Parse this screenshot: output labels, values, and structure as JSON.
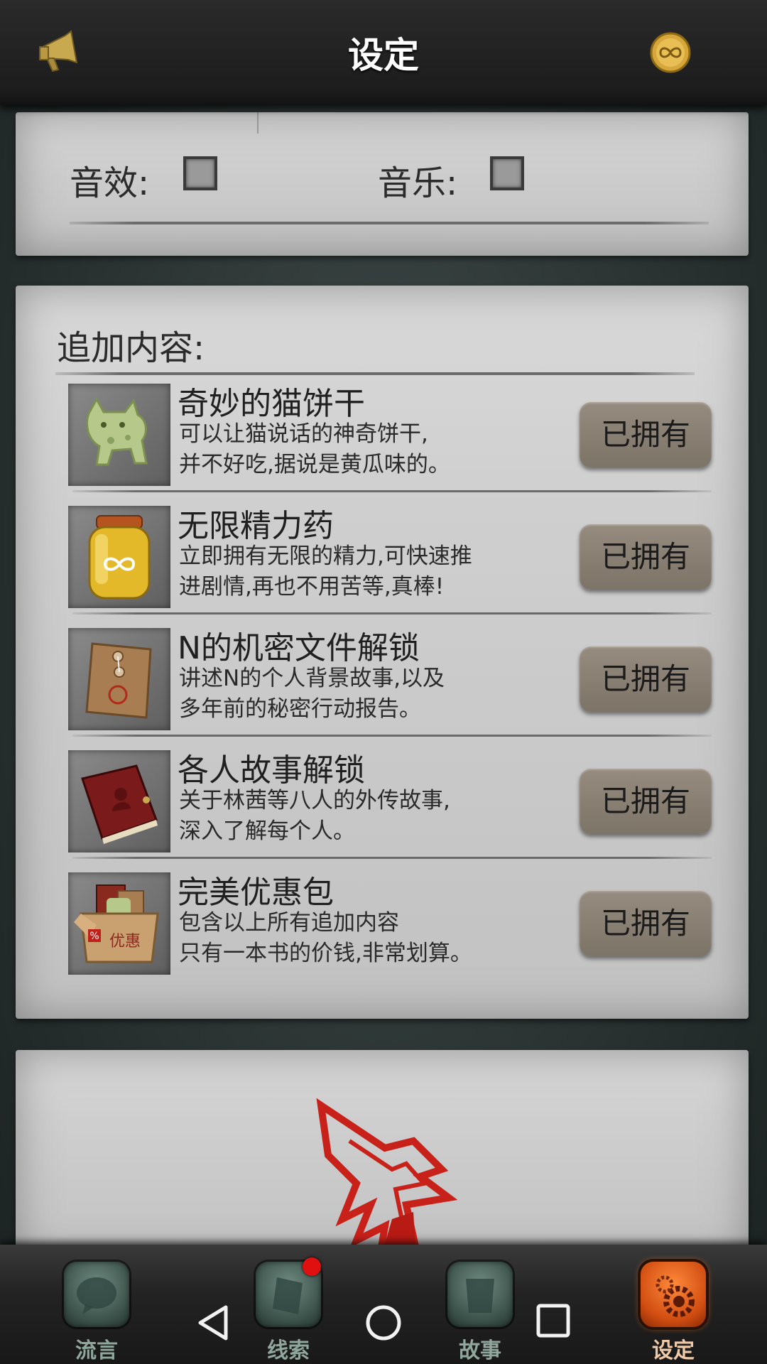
{
  "header": {
    "title": "设定",
    "left_icon": "megaphone-icon",
    "right_icon": "infinity-coin-icon"
  },
  "settings": {
    "sound_effects_label": "音效:",
    "sound_effects_checked": false,
    "music_label": "音乐:",
    "music_checked": false
  },
  "extras": {
    "title": "追加内容:",
    "items": [
      {
        "name": "奇妙的猫饼干",
        "desc": "可以让猫说话的神奇饼干,\n并不好吃,据说是黄瓜味的。",
        "button": "已拥有",
        "icon": "cat-cookie-icon"
      },
      {
        "name": "无限精力药",
        "desc": "立即拥有无限的精力,可快速推\n进剧情,再也不用苦等,真棒!",
        "button": "已拥有",
        "icon": "energy-potion-jar-icon"
      },
      {
        "name": "N的机密文件解锁",
        "desc": "讲述N的个人背景故事,以及\n多年前的秘密行动报告。",
        "button": "已拥有",
        "icon": "secret-envelope-icon"
      },
      {
        "name": "各人故事解锁",
        "desc": "关于林茜等八人的外传故事,\n深入了解每个人。",
        "button": "已拥有",
        "icon": "red-book-icon"
      },
      {
        "name": "完美优惠包",
        "desc": "包含以上所有追加内容\n只有一本书的价钱,非常划算。",
        "button": "已拥有",
        "icon": "bundle-box-icon"
      }
    ],
    "bundle_box_text": "优惠",
    "bundle_box_percent": "%"
  },
  "logo": {
    "icon": "red-wolf-logo-icon"
  },
  "nav": {
    "tabs": [
      {
        "label": "流言",
        "icon": "rumor-chat-icon",
        "active": false
      },
      {
        "label": "线索",
        "icon": "clue-note-icon",
        "active": false,
        "badge": true
      },
      {
        "label": "故事",
        "icon": "story-book-icon",
        "active": false
      },
      {
        "label": "设定",
        "icon": "settings-gear-icon",
        "active": true
      }
    ]
  },
  "colors": {
    "accent_active": "#e0561a",
    "badge": "#e01010",
    "button": "#8a8174"
  }
}
